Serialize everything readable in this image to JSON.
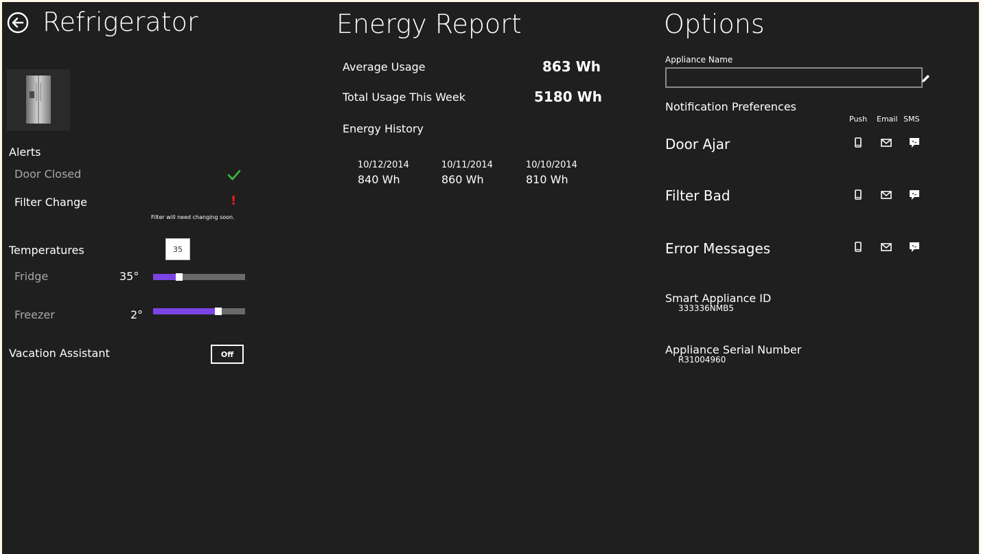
{
  "refrigerator": {
    "title": "Refrigerator",
    "alerts": {
      "heading": "Alerts",
      "door": {
        "label": "Door Closed",
        "status": "ok"
      },
      "filter": {
        "label": "Filter Change",
        "status": "warning",
        "status_symbol": "!",
        "note": "Filter will need changing soon."
      }
    },
    "temperatures": {
      "heading": "Temperatures",
      "box_value": "35",
      "fridge": {
        "label": "Fridge",
        "value_text": "35°",
        "level": 0.28
      },
      "freezer": {
        "label": "Freezer",
        "value_text": "2°",
        "level": 0.71
      }
    },
    "vacation": {
      "label": "Vacation Assistant",
      "toggle": "Off"
    }
  },
  "energy": {
    "title": "Energy Report",
    "average": {
      "label": "Average Usage",
      "value": "863 Wh"
    },
    "total": {
      "label": "Total Usage This Week",
      "value": "5180 Wh"
    },
    "history_heading": "Energy History",
    "history": [
      {
        "date": "10/12/2014",
        "value": "840 Wh"
      },
      {
        "date": "10/11/2014",
        "value": "860 Wh"
      },
      {
        "date": "10/10/2014",
        "value": "810 Wh"
      }
    ]
  },
  "options": {
    "title": "Options",
    "appliance_name_label": "Appliance Name",
    "appliance_name_value": "",
    "notification_heading": "Notification Preferences",
    "channels": [
      "Push",
      "Email",
      "SMS"
    ],
    "notifications": [
      {
        "label": "Door Ajar"
      },
      {
        "label": "Filter Bad"
      },
      {
        "label": "Error Messages"
      }
    ],
    "smart_id": {
      "label": "Smart Appliance ID",
      "value": "333336NMB5"
    },
    "serial": {
      "label": "Appliance Serial Number",
      "value": "R31004960"
    }
  },
  "colors": {
    "background": "#1f1f1f",
    "accent": "#7b45e6",
    "ok": "#39c039",
    "warning": "#e81f1f"
  },
  "icons": [
    "back-arrow-icon",
    "check-icon",
    "exclamation-icon",
    "pencil-icon",
    "phone-icon",
    "mail-icon",
    "chat-icon"
  ]
}
